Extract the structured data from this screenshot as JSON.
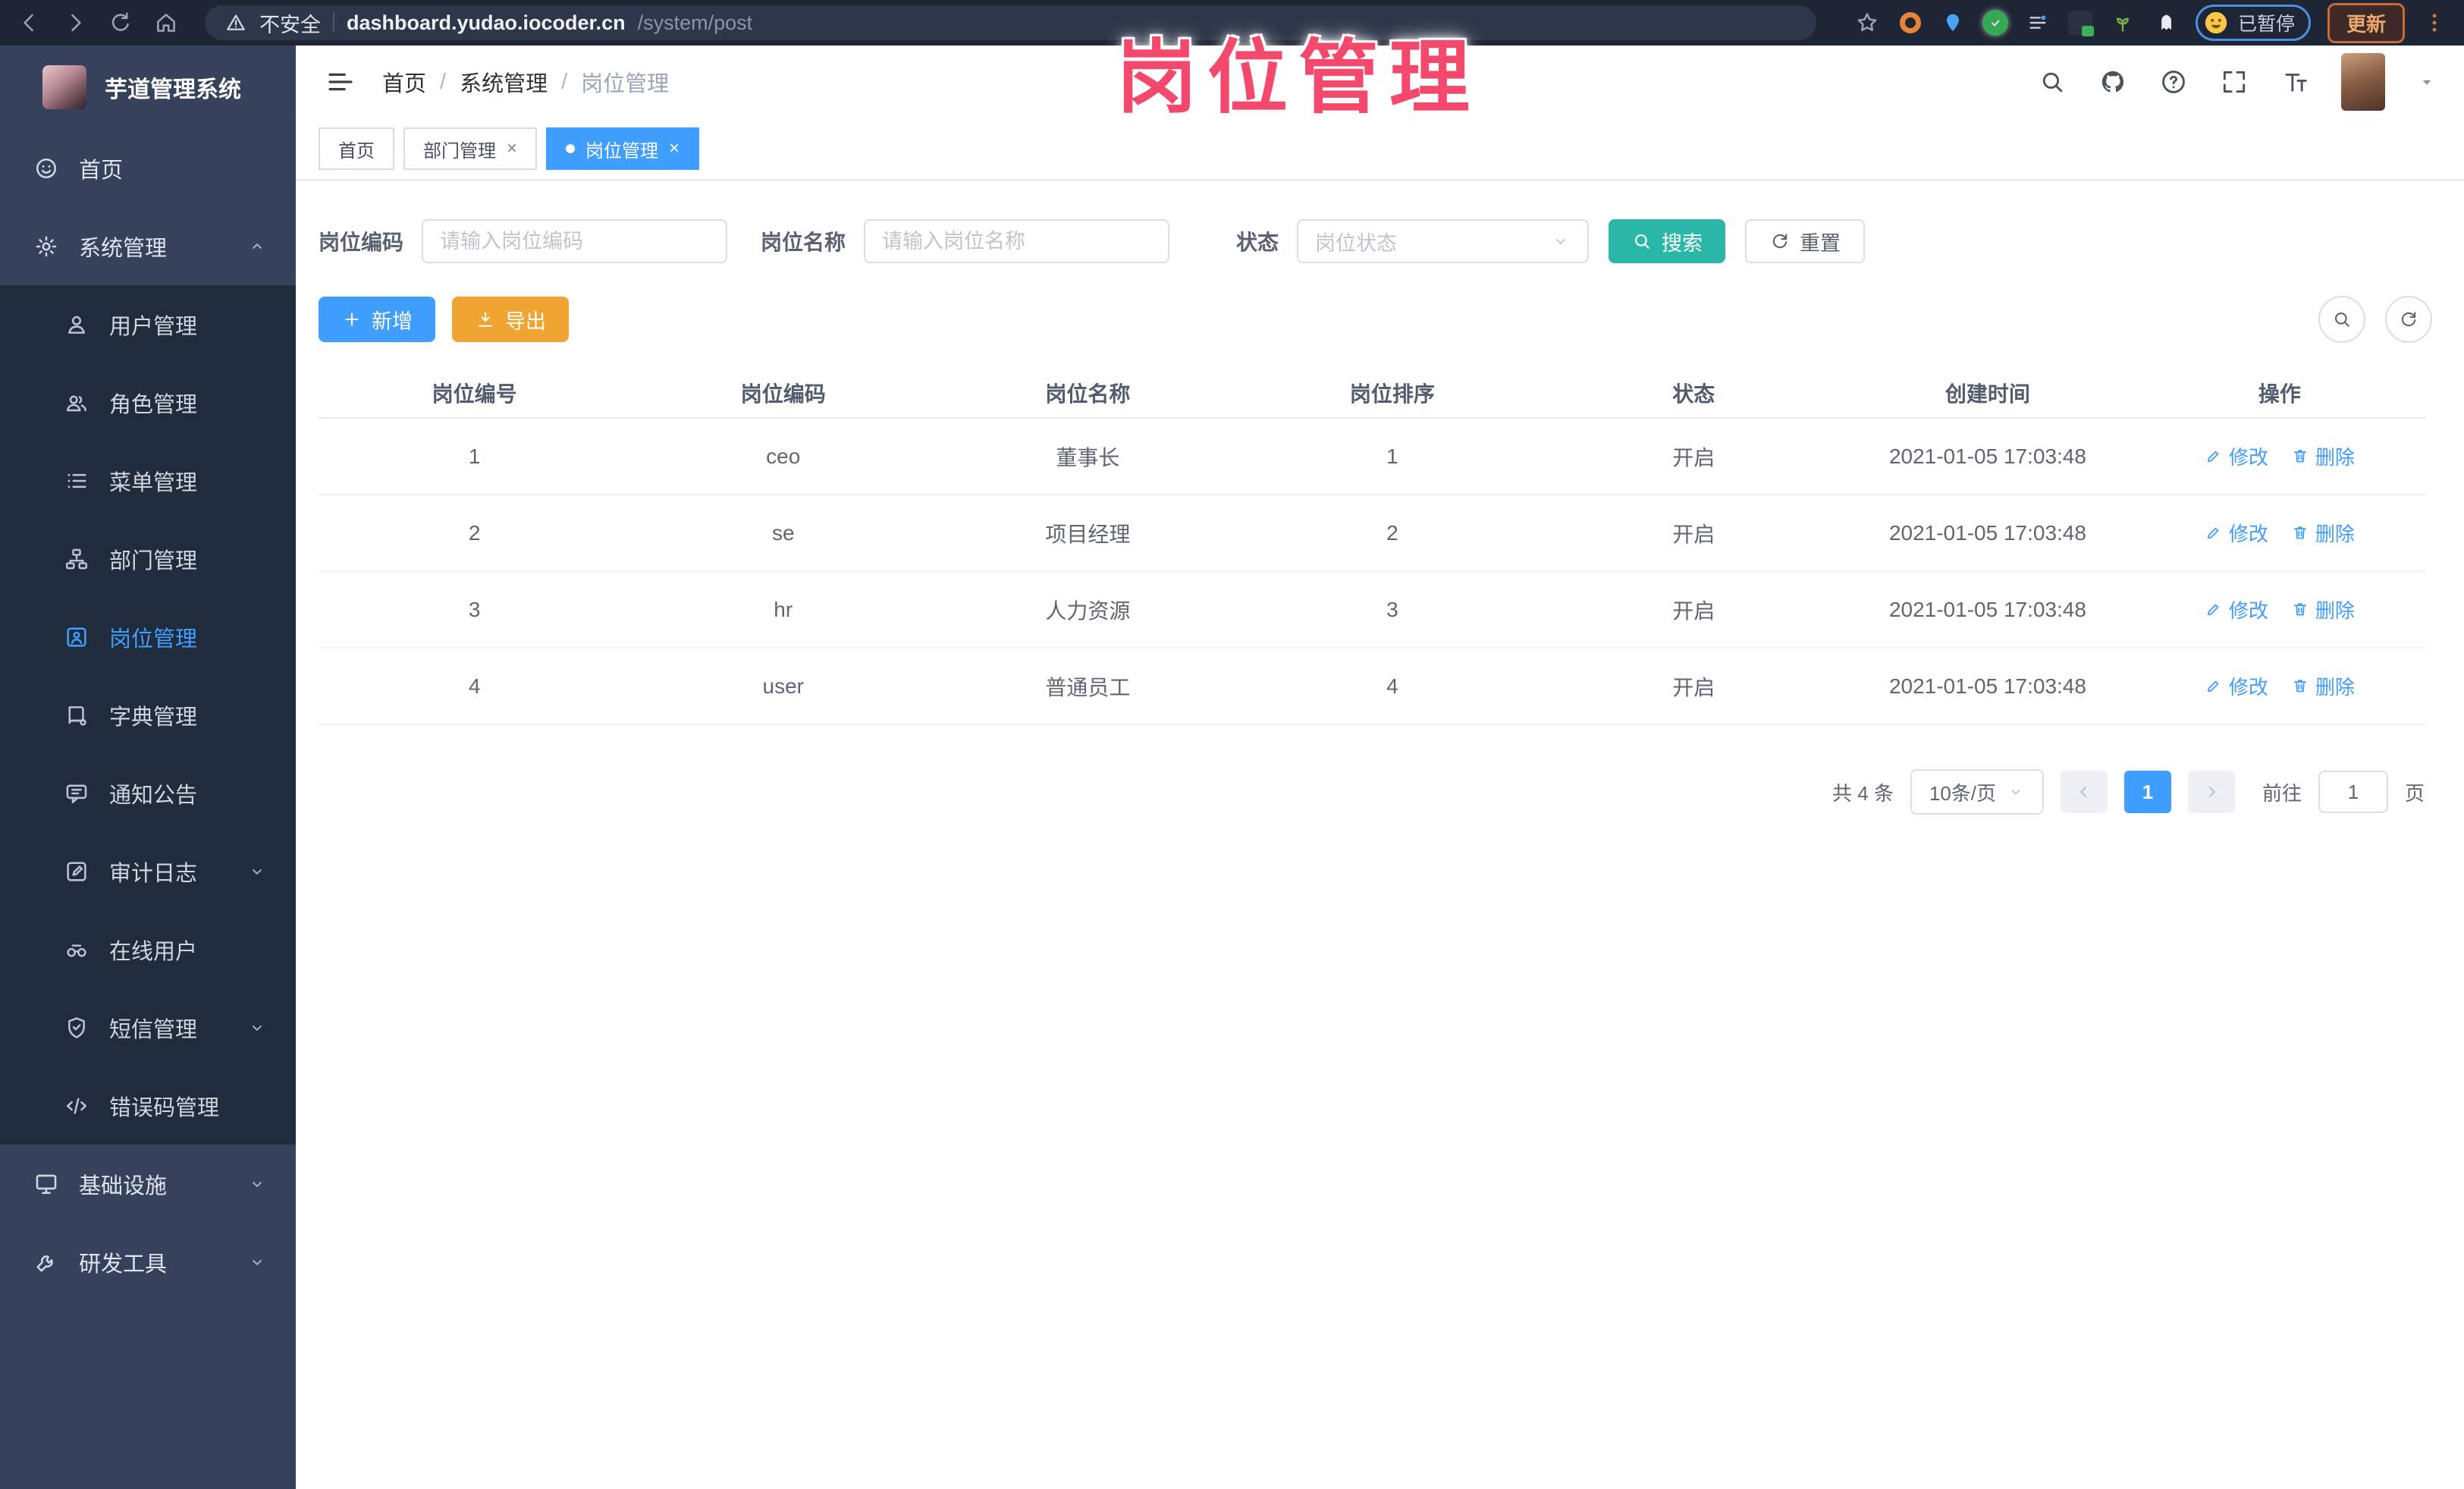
{
  "colors": {
    "accent": "#409eff",
    "search_button": "#2bb7a7",
    "export_button": "#f0a432",
    "annotation": "#f4486c",
    "sidebar_bg": "#36425c",
    "submenu_bg": "#202b3c",
    "chrome_bg": "#1e2534"
  },
  "browser": {
    "security_warning": "不安全",
    "url_host": "dashboard.yudao.iocoder.cn",
    "url_path": "/system/post",
    "paused_badge": "已暂停",
    "update_button": "更新",
    "extension_icons": [
      "orange-ring-extension-icon",
      "location-pin-extension-icon",
      "green-check-extension-icon",
      "sliders-extension-icon",
      "card-badge-extension-icon",
      "sprout-extension-icon",
      "ghost-extension-icon"
    ]
  },
  "annotation": {
    "text": "岗位管理"
  },
  "sidebar": {
    "logo_title": "芋道管理系统",
    "items": [
      {
        "label": "首页",
        "icon": "dashboard-smiley-icon",
        "level": "top"
      },
      {
        "label": "系统管理",
        "icon": "gear-icon",
        "level": "top",
        "chevron": "up"
      },
      {
        "label": "用户管理",
        "icon": "user-icon",
        "level": "sub"
      },
      {
        "label": "角色管理",
        "icon": "users-icon",
        "level": "sub"
      },
      {
        "label": "菜单管理",
        "icon": "menu-list-icon",
        "level": "sub"
      },
      {
        "label": "部门管理",
        "icon": "org-tree-icon",
        "level": "sub"
      },
      {
        "label": "岗位管理",
        "icon": "id-badge-icon",
        "level": "sub",
        "active": true
      },
      {
        "label": "字典管理",
        "icon": "dictionary-icon",
        "level": "sub"
      },
      {
        "label": "通知公告",
        "icon": "announcement-icon",
        "level": "sub"
      },
      {
        "label": "审计日志",
        "icon": "audit-log-icon",
        "level": "sub",
        "chevron": "down"
      },
      {
        "label": "在线用户",
        "icon": "online-users-icon",
        "level": "sub"
      },
      {
        "label": "短信管理",
        "icon": "sms-shield-icon",
        "level": "sub",
        "chevron": "down"
      },
      {
        "label": "错误码管理",
        "icon": "error-code-icon",
        "level": "sub"
      },
      {
        "label": "基础设施",
        "icon": "infrastructure-icon",
        "level": "top",
        "chevron": "down"
      },
      {
        "label": "研发工具",
        "icon": "dev-tools-icon",
        "level": "top",
        "chevron": "down"
      }
    ]
  },
  "header": {
    "breadcrumb": [
      "首页",
      "系统管理",
      "岗位管理"
    ]
  },
  "tabs": [
    {
      "label": "首页",
      "active": false,
      "closable": false
    },
    {
      "label": "部门管理",
      "active": false,
      "closable": true
    },
    {
      "label": "岗位管理",
      "active": true,
      "closable": true
    }
  ],
  "filters": {
    "post_code_label": "岗位编码",
    "post_code_placeholder": "请输入岗位编码",
    "post_name_label": "岗位名称",
    "post_name_placeholder": "请输入岗位名称",
    "status_label": "状态",
    "status_placeholder": "岗位状态",
    "search_label": "搜索",
    "reset_label": "重置"
  },
  "toolbar": {
    "add_label": "新增",
    "export_label": "导出"
  },
  "table": {
    "columns": [
      "岗位编号",
      "岗位编码",
      "岗位名称",
      "岗位排序",
      "状态",
      "创建时间",
      "操作"
    ],
    "rows": [
      {
        "post_id": "1",
        "code": "ceo",
        "name": "董事长",
        "sort": "1",
        "status": "开启",
        "created_at": "2021-01-05 17:03:48"
      },
      {
        "post_id": "2",
        "code": "se",
        "name": "项目经理",
        "sort": "2",
        "status": "开启",
        "created_at": "2021-01-05 17:03:48"
      },
      {
        "post_id": "3",
        "code": "hr",
        "name": "人力资源",
        "sort": "3",
        "status": "开启",
        "created_at": "2021-01-05 17:03:48"
      },
      {
        "post_id": "4",
        "code": "user",
        "name": "普通员工",
        "sort": "4",
        "status": "开启",
        "created_at": "2021-01-05 17:03:48"
      }
    ],
    "edit_label": "修改",
    "delete_label": "删除"
  },
  "pagination": {
    "total_text": "共 4 条",
    "page_size_text": "10条/页",
    "current_page": "1",
    "goto_prefix": "前往",
    "goto_value": "1",
    "goto_suffix": "页"
  }
}
